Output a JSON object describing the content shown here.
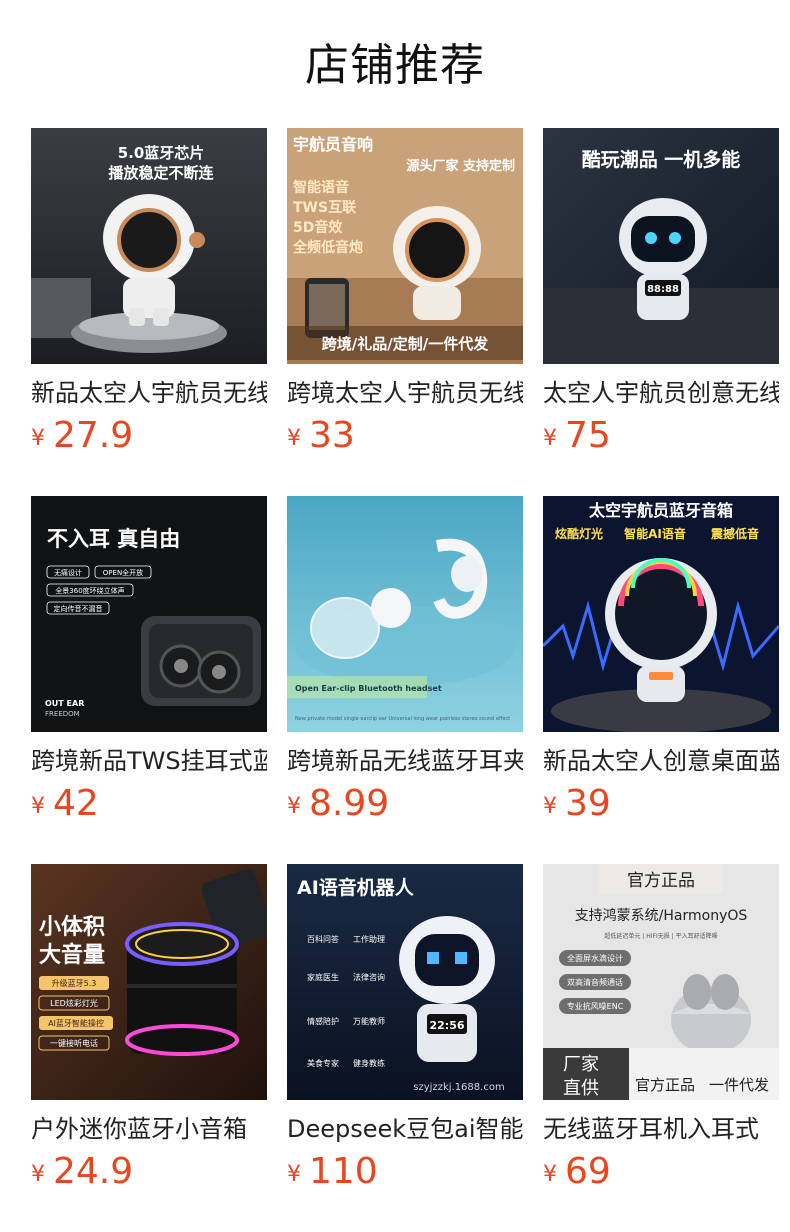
{
  "section_title": "店铺推荐",
  "products": [
    {
      "name": "新品太空人宇航员无线蓝牙音箱",
      "price": "27.9",
      "currency": "¥",
      "image_text": [
        "5.0蓝牙芯片",
        "播放稳定不断连"
      ],
      "image_icon": "astronaut-speaker-white"
    },
    {
      "name": "跨境太空人宇航员无线蓝牙音箱",
      "price": "33",
      "currency": "¥",
      "image_text": [
        "宇航员音响",
        "源头厂家 支持定制",
        "智能语音",
        "TWS互联",
        "5D音效",
        "全频低音炮",
        "跨境/礼品/定制/一件代发"
      ],
      "image_icon": "astronaut-speaker-gold"
    },
    {
      "name": "太空人宇航员创意无线蓝牙音箱",
      "price": "75",
      "currency": "¥",
      "image_text": [
        "酷玩潮品 一机多能",
        "88:88"
      ],
      "image_icon": "robot-astronaut-clock"
    },
    {
      "name": "跨境新品TWS挂耳式蓝牙耳机",
      "price": "42",
      "currency": "¥",
      "image_text": [
        "不入耳 真自由",
        "无痛设计",
        "OPEN全开放",
        "全景360度环绕立体声",
        "定向传音不漏音",
        "OUT EAR",
        "FREEDOM"
      ],
      "image_icon": "open-ear-earbuds"
    },
    {
      "name": "跨境新品无线蓝牙耳夹式耳机",
      "price": "8.99",
      "currency": "¥",
      "image_text": [
        "Open Ear-clip Bluetooth headset",
        "New private model single earclip ear Universal long wear painless stereo sound effect"
      ],
      "image_icon": "ear-clip-headset"
    },
    {
      "name": "新品太空人创意桌面蓝牙音箱",
      "price": "39",
      "currency": "¥",
      "image_text": [
        "太空宇航员蓝牙音箱",
        "炫酷灯光",
        "智能AI语音",
        "震撼低音"
      ],
      "image_icon": "rgb-astronaut-speaker"
    },
    {
      "name": "户外迷你蓝牙小音箱",
      "price": "24.9",
      "currency": "¥",
      "image_text": [
        "小体积",
        "大音量",
        "升级蓝牙5.3",
        "LED炫彩灯光",
        "AI蓝牙智能操控",
        "一键接听电话"
      ],
      "image_icon": "mini-rgb-speaker"
    },
    {
      "name": "Deepseek豆包ai智能机器人",
      "price": "110",
      "currency": "¥",
      "image_text": [
        "AI语音机器人",
        "百科问答",
        "工作助理",
        "家庭医生",
        "法律咨询",
        "情感陪护",
        "万能教师",
        "美食专家",
        "健身教练",
        "22:56",
        "szyjzzkj.1688.com"
      ],
      "image_icon": "ai-robot-astronaut"
    },
    {
      "name": "无线蓝牙耳机入耳式",
      "price": "69",
      "currency": "¥",
      "image_text": [
        "官方正品",
        "支持鸿蒙系统/HarmonyOS",
        "超低延迟单元 | HIFI无损 | 平入耳舒适降噪",
        "全面屏水滴设计",
        "双高清音频通话",
        "专业抗风噪ENC",
        "厂家",
        "直供",
        "官方正品",
        "一件代发"
      ],
      "image_icon": "earbuds-case-silver"
    }
  ]
}
